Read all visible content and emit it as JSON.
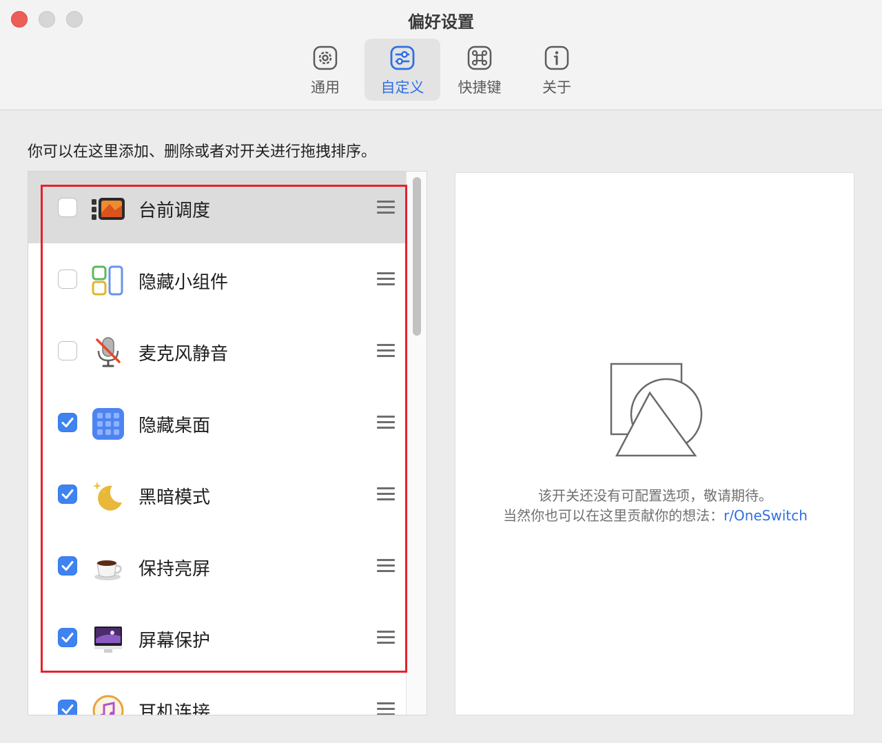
{
  "window": {
    "title": "偏好设置"
  },
  "tabs": [
    {
      "label": "通用",
      "icon": "gear-icon",
      "active": false
    },
    {
      "label": "自定义",
      "icon": "sliders-icon",
      "active": true
    },
    {
      "label": "快捷键",
      "icon": "command-icon",
      "active": false
    },
    {
      "label": "关于",
      "icon": "info-icon",
      "active": false
    }
  ],
  "instruction": "你可以在这里添加、删除或者对开关进行拖拽排序。",
  "switches": [
    {
      "label": "台前调度",
      "checked": false,
      "icon": "stage-manager-icon"
    },
    {
      "label": "隐藏小组件",
      "checked": false,
      "icon": "widgets-icon"
    },
    {
      "label": "麦克风静音",
      "checked": false,
      "icon": "microphone-muted-icon"
    },
    {
      "label": "隐藏桌面",
      "checked": true,
      "icon": "desktop-grid-icon"
    },
    {
      "label": "黑暗模式",
      "checked": true,
      "icon": "moon-icon"
    },
    {
      "label": "保持亮屏",
      "checked": true,
      "icon": "coffee-cup-icon"
    },
    {
      "label": "屏幕保护",
      "checked": true,
      "icon": "screensaver-icon"
    },
    {
      "label": "耳机连接",
      "checked": true,
      "icon": "headphones-icon"
    }
  ],
  "detail": {
    "line1": "该开关还没有可配置选项，敬请期待。",
    "line2_prefix": "当然你也可以在这里贡献你的想法：",
    "link_text": "r/OneSwitch"
  },
  "colors": {
    "accent": "#2f6fe4",
    "checkbox": "#3e83f0",
    "highlight_border": "#e4212b"
  }
}
